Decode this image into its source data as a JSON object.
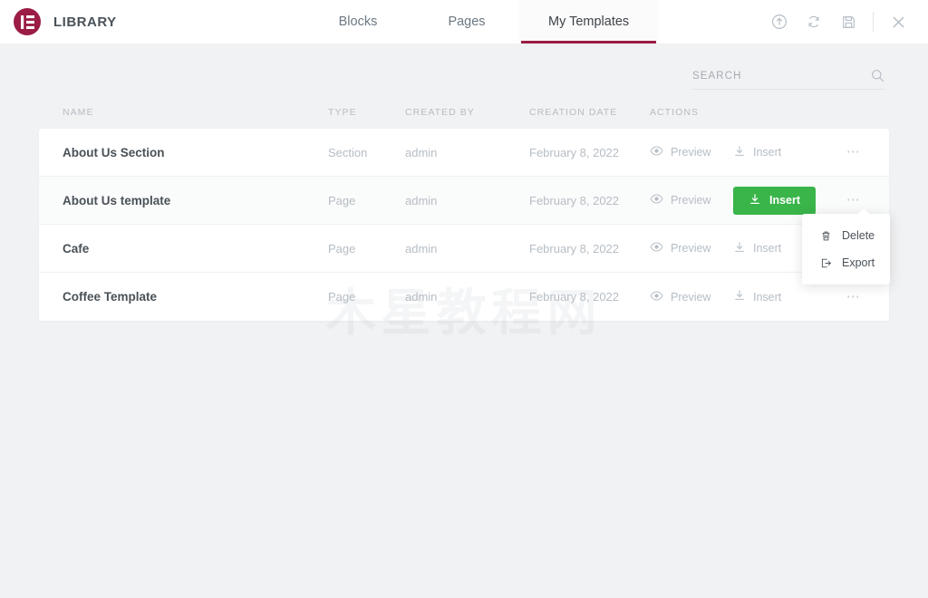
{
  "header": {
    "logo_name": "elementor-logo",
    "title": "LIBRARY",
    "tabs": [
      {
        "label": "Blocks",
        "active": false
      },
      {
        "label": "Pages",
        "active": false
      },
      {
        "label": "My Templates",
        "active": true
      }
    ],
    "actions": [
      {
        "name": "upload-icon"
      },
      {
        "name": "sync-icon"
      },
      {
        "name": "save-icon"
      },
      {
        "name": "close-icon"
      }
    ],
    "accent_color": "#9b1c45"
  },
  "search": {
    "placeholder": "SEARCH",
    "value": "",
    "icon": "search-icon"
  },
  "table": {
    "columns": [
      "NAME",
      "TYPE",
      "CREATED BY",
      "CREATION DATE",
      "ACTIONS"
    ],
    "rows": [
      {
        "name": "About Us Section",
        "type": "Section",
        "created_by": "admin",
        "creation_date": "February 8, 2022",
        "preview_label": "Preview",
        "insert_label": "Insert",
        "insert_active": false,
        "hover": false,
        "menu_open": false
      },
      {
        "name": "About Us template",
        "type": "Page",
        "created_by": "admin",
        "creation_date": "February 8, 2022",
        "preview_label": "Preview",
        "insert_label": "Insert",
        "insert_active": true,
        "hover": true,
        "menu_open": true
      },
      {
        "name": "Cafe",
        "type": "Page",
        "created_by": "admin",
        "creation_date": "February 8, 2022",
        "preview_label": "Preview",
        "insert_label": "Insert",
        "insert_active": false,
        "hover": false,
        "menu_open": false
      },
      {
        "name": "Coffee Template",
        "type": "Page",
        "created_by": "admin",
        "creation_date": "February 8, 2022",
        "preview_label": "Preview",
        "insert_label": "Insert",
        "insert_active": false,
        "hover": false,
        "menu_open": false
      }
    ]
  },
  "context_menu": {
    "items": [
      {
        "label": "Delete",
        "icon": "trash-icon"
      },
      {
        "label": "Export",
        "icon": "export-icon"
      }
    ]
  },
  "watermark": {
    "text": "木星教程网"
  },
  "colors": {
    "insert_green": "#39b54a",
    "brand_maroon": "#9b1c45",
    "page_background": "#f1f2f3"
  }
}
